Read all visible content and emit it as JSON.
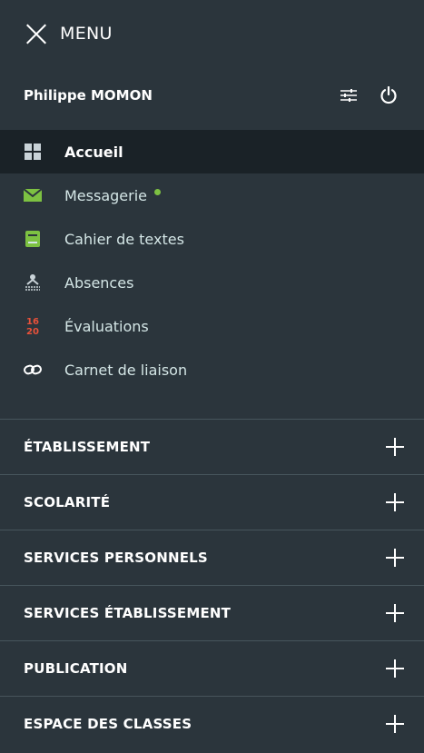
{
  "header": {
    "title": "MENU"
  },
  "user": {
    "name": "Philippe MOMON"
  },
  "nav": {
    "items": [
      {
        "label": "Accueil",
        "icon": "grid-icon"
      },
      {
        "label": "Messagerie",
        "icon": "envelope-icon",
        "unread": true
      },
      {
        "label": "Cahier de textes",
        "icon": "notebook-icon"
      },
      {
        "label": "Absences",
        "icon": "absences-icon"
      },
      {
        "label": "Évaluations",
        "icon": "grade-icon",
        "icon_top": "16",
        "icon_bottom": "20"
      },
      {
        "label": "Carnet de liaison",
        "icon": "link-icon"
      }
    ]
  },
  "sections": [
    {
      "label": "ÉTABLISSEMENT"
    },
    {
      "label": "SCOLARITÉ"
    },
    {
      "label": "SERVICES PERSONNELS"
    },
    {
      "label": "SERVICES ÉTABLISSEMENT"
    },
    {
      "label": "PUBLICATION"
    },
    {
      "label": "ESPACE DES CLASSES"
    }
  ],
  "colors": {
    "background": "#2b353c",
    "active_background": "#1a2227",
    "nav_text": "#d4e6e6",
    "accent_green": "#7dc142",
    "grade_red": "#e8513a",
    "divider": "#47555c"
  }
}
